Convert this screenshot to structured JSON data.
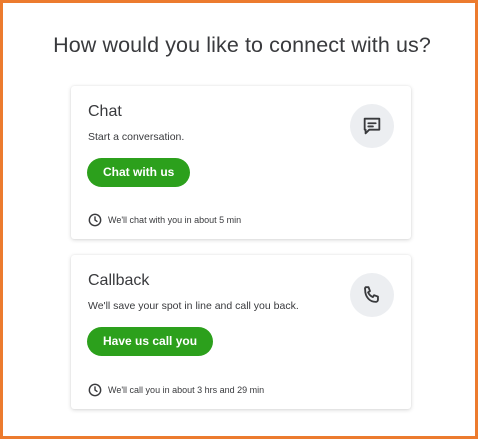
{
  "heading": "How would you like to connect with us?",
  "options": [
    {
      "title": "Chat",
      "description": "Start a conversation.",
      "button_label": "Chat with us",
      "wait_text": "We'll chat with you in about 5 min",
      "icon": "chat-bubble-icon"
    },
    {
      "title": "Callback",
      "description": "We'll save your spot in line and call you back.",
      "button_label": "Have us call you",
      "wait_text": "We'll call you in about 3 hrs and 29 min",
      "icon": "phone-icon"
    }
  ],
  "colors": {
    "frame_border": "#ec7b2e",
    "button_green": "#2ca01c",
    "text": "#393a3d",
    "icon_circle": "#eceef1"
  }
}
